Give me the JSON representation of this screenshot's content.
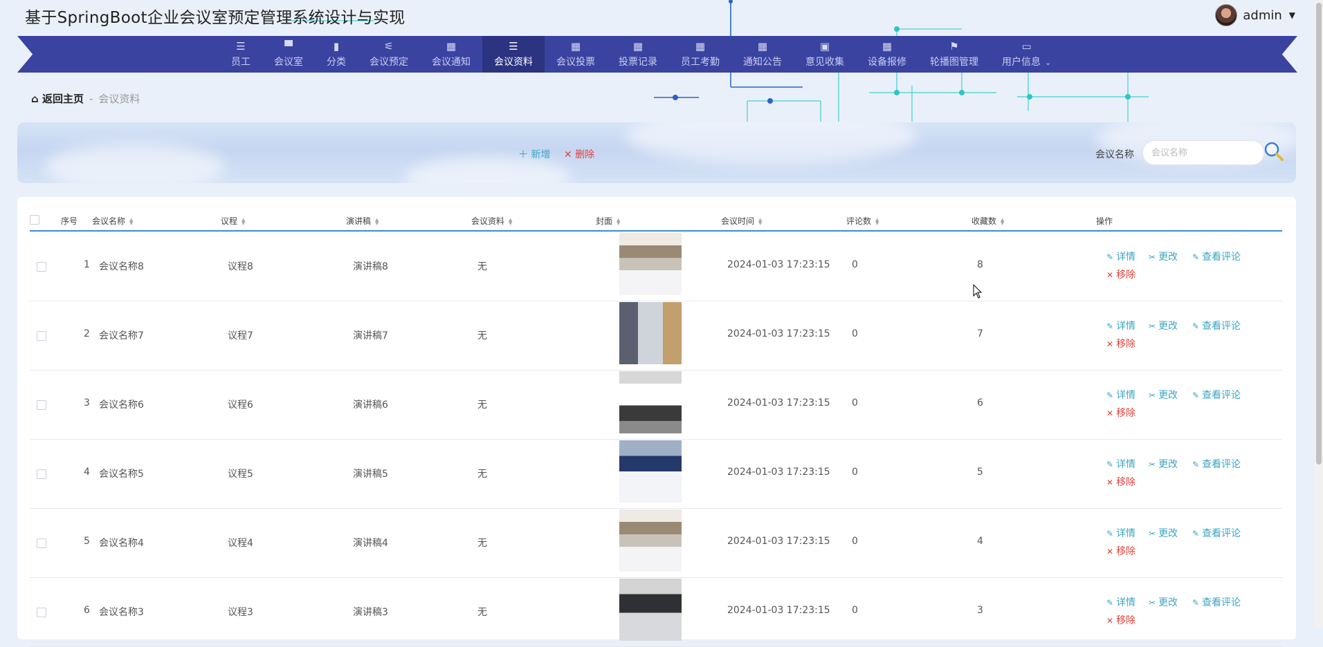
{
  "header": {
    "title": "基于SpringBoot企业会议室预定管理系统设计与实现",
    "username": "admin"
  },
  "nav": {
    "items": [
      {
        "label": "员工",
        "icon": "list-icon"
      },
      {
        "label": "会议室",
        "icon": "chair-icon"
      },
      {
        "label": "分类",
        "icon": "bar-chart-icon"
      },
      {
        "label": "会议预定",
        "icon": "sliders-icon"
      },
      {
        "label": "会议通知",
        "icon": "grid-icon"
      },
      {
        "label": "会议资料",
        "icon": "list-icon"
      },
      {
        "label": "会议投票",
        "icon": "grid-icon"
      },
      {
        "label": "投票记录",
        "icon": "grid-icon"
      },
      {
        "label": "员工考勤",
        "icon": "grid-icon"
      },
      {
        "label": "通知公告",
        "icon": "grid-icon"
      },
      {
        "label": "意见收集",
        "icon": "briefcase-icon"
      },
      {
        "label": "设备报修",
        "icon": "grid-icon"
      },
      {
        "label": "轮播图管理",
        "icon": "flag-icon"
      },
      {
        "label": "用户信息",
        "icon": "window-icon"
      }
    ],
    "active": "会议资料"
  },
  "breadcrumb": {
    "home": "返回主页",
    "separator": "-",
    "current": "会议资料"
  },
  "toolbar": {
    "add_label": "新增",
    "delete_label": "删除",
    "search_label": "会议名称",
    "search_placeholder": "会议名称"
  },
  "table": {
    "columns": [
      "序号",
      "会议名称",
      "议程",
      "演讲稿",
      "会议资料",
      "封面",
      "会议时间",
      "评论数",
      "收藏数",
      "操作"
    ],
    "actions": {
      "detail": "详情",
      "edit": "更改",
      "comments": "查看评论",
      "remove": "移除"
    },
    "rows": [
      {
        "index": "1",
        "name": "会议名称8",
        "agenda": "议程8",
        "speech": "演讲稿8",
        "material": "无",
        "time": "2024-01-03 17:23:15",
        "comments": "0",
        "favorites": "8"
      },
      {
        "index": "2",
        "name": "会议名称7",
        "agenda": "议程7",
        "speech": "演讲稿7",
        "material": "无",
        "time": "2024-01-03 17:23:15",
        "comments": "0",
        "favorites": "7"
      },
      {
        "index": "3",
        "name": "会议名称6",
        "agenda": "议程6",
        "speech": "演讲稿6",
        "material": "无",
        "time": "2024-01-03 17:23:15",
        "comments": "0",
        "favorites": "6"
      },
      {
        "index": "4",
        "name": "会议名称5",
        "agenda": "议程5",
        "speech": "演讲稿5",
        "material": "无",
        "time": "2024-01-03 17:23:15",
        "comments": "0",
        "favorites": "5"
      },
      {
        "index": "5",
        "name": "会议名称4",
        "agenda": "议程4",
        "speech": "演讲稿4",
        "material": "无",
        "time": "2024-01-03 17:23:15",
        "comments": "0",
        "favorites": "4"
      },
      {
        "index": "6",
        "name": "会议名称3",
        "agenda": "议程3",
        "speech": "演讲稿3",
        "material": "无",
        "time": "2024-01-03 17:23:15",
        "comments": "0",
        "favorites": "3"
      }
    ]
  },
  "colors": {
    "nav_bg": "#3a43a0",
    "nav_active": "#2c3380",
    "accent": "#3aa5c4",
    "danger": "#e0433d",
    "header_border": "#3d8bd6"
  }
}
